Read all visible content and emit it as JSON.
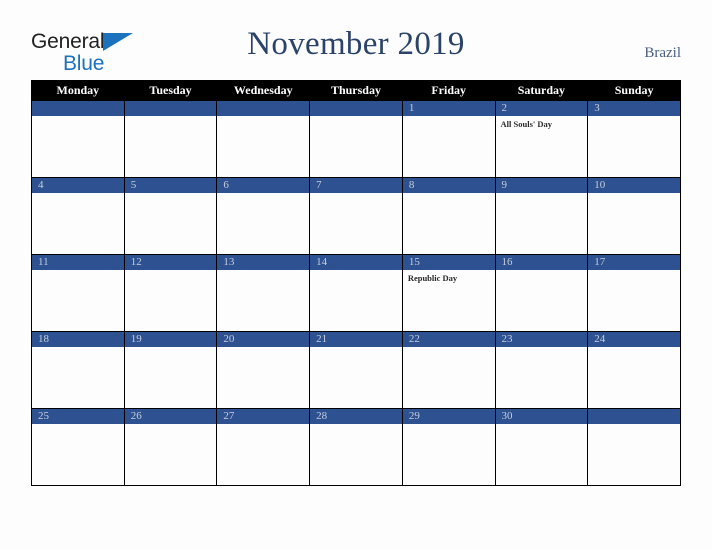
{
  "header": {
    "logo": {
      "text_top": "General",
      "text_bottom": "Blue",
      "triangle_icon": "triangle-icon",
      "color_dark": "#222222",
      "color_blue": "#1c72bd"
    },
    "title": "November 2019",
    "country": "Brazil"
  },
  "colors": {
    "header_row_bg": "#000000",
    "day_bar_bg": "#2d5191",
    "day_number_text": "#c6cddb",
    "title_text": "#2b4368",
    "country_text": "#4a5f80",
    "page_bg": "#fdfdfd",
    "grid_line": "#000000"
  },
  "calendar": {
    "weekdays": [
      "Monday",
      "Tuesday",
      "Wednesday",
      "Thursday",
      "Friday",
      "Saturday",
      "Sunday"
    ],
    "weeks": [
      [
        {
          "day": "",
          "events": []
        },
        {
          "day": "",
          "events": []
        },
        {
          "day": "",
          "events": []
        },
        {
          "day": "",
          "events": []
        },
        {
          "day": "1",
          "events": []
        },
        {
          "day": "2",
          "events": [
            "All Souls' Day"
          ]
        },
        {
          "day": "3",
          "events": []
        }
      ],
      [
        {
          "day": "4",
          "events": []
        },
        {
          "day": "5",
          "events": []
        },
        {
          "day": "6",
          "events": []
        },
        {
          "day": "7",
          "events": []
        },
        {
          "day": "8",
          "events": []
        },
        {
          "day": "9",
          "events": []
        },
        {
          "day": "10",
          "events": []
        }
      ],
      [
        {
          "day": "11",
          "events": []
        },
        {
          "day": "12",
          "events": []
        },
        {
          "day": "13",
          "events": []
        },
        {
          "day": "14",
          "events": []
        },
        {
          "day": "15",
          "events": [
            "Republic Day"
          ]
        },
        {
          "day": "16",
          "events": []
        },
        {
          "day": "17",
          "events": []
        }
      ],
      [
        {
          "day": "18",
          "events": []
        },
        {
          "day": "19",
          "events": []
        },
        {
          "day": "20",
          "events": []
        },
        {
          "day": "21",
          "events": []
        },
        {
          "day": "22",
          "events": []
        },
        {
          "day": "23",
          "events": []
        },
        {
          "day": "24",
          "events": []
        }
      ],
      [
        {
          "day": "25",
          "events": []
        },
        {
          "day": "26",
          "events": []
        },
        {
          "day": "27",
          "events": []
        },
        {
          "day": "28",
          "events": []
        },
        {
          "day": "29",
          "events": []
        },
        {
          "day": "30",
          "events": []
        },
        {
          "day": "",
          "events": []
        }
      ]
    ]
  }
}
